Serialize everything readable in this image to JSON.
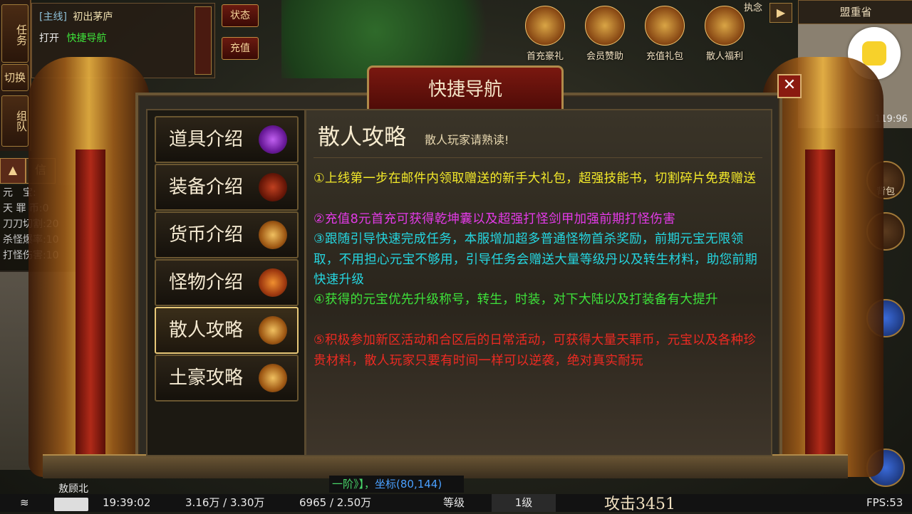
{
  "quest": {
    "side_task": "任务",
    "side_switch": "切换",
    "side_team": "组队",
    "main_tag": "[主线]",
    "main_name": "初出茅庐",
    "open_prefix": "打开",
    "open_link": "快捷导航",
    "status_btn": "状态",
    "recharge_btn": "充值",
    "info_tab": "信"
  },
  "stats": [
    {
      "label": "元　宝:",
      "value": ""
    },
    {
      "label": "天 罪 币:",
      "value": "0"
    },
    {
      "label": "刀刀切割:",
      "value": "20"
    },
    {
      "label": "杀怪爆率:",
      "value": "10"
    },
    {
      "label": "打怪伤害:",
      "value": "10"
    }
  ],
  "top_icons": [
    "首充豪礼",
    "会员赞助",
    "充值礼包",
    "散人福利"
  ],
  "top_right": {
    "hint": "执念",
    "map_name": "盟重省",
    "ping": "119:96",
    "bag": "背包"
  },
  "dialog": {
    "title": "快捷导航",
    "close": "✕",
    "nav": [
      {
        "label": "道具介绍",
        "icon": "potion-icon"
      },
      {
        "label": "装备介绍",
        "icon": "armor-icon"
      },
      {
        "label": "货币介绍",
        "icon": "gold-icon"
      },
      {
        "label": "怪物介绍",
        "icon": "monster-icon"
      },
      {
        "label": "散人攻略",
        "icon": "scroll-icon"
      },
      {
        "label": "土豪攻略",
        "icon": "scroll-icon"
      }
    ],
    "active_index": 4,
    "content_title": "散人攻略",
    "content_subtitle": "散人玩家请熟读!",
    "paragraphs": [
      {
        "text": "①上线第一步在邮件内领取赠送的新手大礼包，超强技能书，切割碎片免费赠送",
        "color": "#f3e92a"
      },
      {
        "text": "②充值8元首充可获得乾坤囊以及超强打怪剑甲加强前期打怪伤害",
        "color": "#e43ae8"
      },
      {
        "text": "③跟随引导快速完成任务，本服增加超多普通怪物首杀奖励，前期元宝无限领取，不用担心元宝不够用，引导任务会赠送大量等级丹以及转生材料，助您前期快速升级",
        "color": "#25d6e0"
      },
      {
        "text": "④获得的元宝优先升级称号，转生，时装，对下大陆以及打装备有大提升",
        "color": "#3ee23a"
      },
      {
        "text": "⑤积极参加新区活动和合区后的日常活动，可获得大量天罪币，元宝以及各种珍贵材料，散人玩家只要有时间一样可以逆袭，绝对真实耐玩",
        "color": "#ee2a22"
      }
    ]
  },
  "bottom": {
    "player_name": "敖顾北",
    "coord_prefix": "一阶》】，",
    "coord": "坐标(80,144)",
    "time": "19:39:02",
    "hp": "3.16万 / 3.30万",
    "mp": "6965 / 2.50万",
    "level_label": "等级",
    "level_value": "1级",
    "attack": "攻击3451",
    "fps": "FPS:53"
  }
}
